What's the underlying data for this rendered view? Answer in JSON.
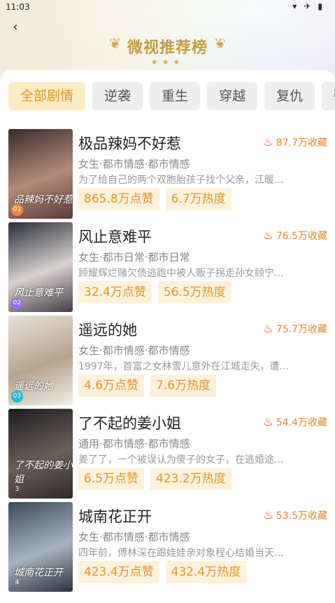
{
  "status": {
    "time": "11:03"
  },
  "header": {
    "back_icon": "‹",
    "title": "微视推荐榜",
    "stars": "★★★"
  },
  "tabs": [
    {
      "label": "全部剧情",
      "active": true
    },
    {
      "label": "逆袭",
      "active": false
    },
    {
      "label": "重生",
      "active": false
    },
    {
      "label": "穿越",
      "active": false
    },
    {
      "label": "复仇",
      "active": false
    },
    {
      "label": "强",
      "active": false
    }
  ],
  "items": [
    {
      "rank": "01",
      "rank_color": "#f0893a",
      "cover_text": "品辣妈不好惹",
      "cover_colors": [
        "#3a2b2b",
        "#b38b7a",
        "#5b3c3a"
      ],
      "title": "极品辣妈不好惹",
      "favorites": "87.7万收藏",
      "meta": "女生·都市情感·都市情感",
      "desc": "为了给自己的两个双胞胎孩子找个父亲，江暖...",
      "likes": "865.8万点赞",
      "heat": "6.7万热度"
    },
    {
      "rank": "02",
      "rank_color": "#9a6ee6",
      "cover_text": "风止意难平",
      "cover_colors": [
        "#2a2e3a",
        "#d8d1cf",
        "#443d44"
      ],
      "title": "风止意难平",
      "favorites": "76.5万收藏",
      "meta": "女生·都市日常·都市日常",
      "desc": "顾耀辉烂赌欠债逃跑中被人贩子拐走孙女顾宁...",
      "likes": "32.4万点赞",
      "heat": "56.5万热度"
    },
    {
      "rank": "03",
      "rank_color": "#27b7d7",
      "cover_text": "遥远的她",
      "cover_colors": [
        "#e9e2d8",
        "#b5a48f",
        "#f3efe8"
      ],
      "title": "遥远的她",
      "favorites": "75.7万收藏",
      "meta": "女生·都市情感·都市情感",
      "desc": "1997年，首富之女林雪儿意外在江城走失，遭...",
      "likes": "4.6万点赞",
      "heat": "7.6万热度"
    },
    {
      "rank": "3",
      "rank_color": "rgba(0,0,0,0)",
      "cover_text": "了不起的姜小姐",
      "cover_colors": [
        "#1d1d1f",
        "#6b5f5a",
        "#2e2a2a"
      ],
      "title": "了不起的姜小姐",
      "favorites": "54.4万收藏",
      "meta": "通用·都市情感·都市情感",
      "desc": "姜了了，一个被误认为傻子的女子，在逃婚途...",
      "likes": "6.5万点赞",
      "heat": "423.2万热度"
    },
    {
      "rank": "4",
      "rank_color": "rgba(0,0,0,0)",
      "cover_text": "城南花正开",
      "cover_colors": [
        "#3b4a5a",
        "#a7b3bf",
        "#2b3440"
      ],
      "title": "城南花正开",
      "favorites": "53.5万收藏",
      "meta": "女生·都市情感·都市情感",
      "desc": "四年前，傅林深在跟娃娃亲对象程心结婚当天...",
      "likes": "423.4万点赞",
      "heat": "432.4万热度"
    }
  ],
  "colors": {
    "accent": "#e3962a",
    "flame": "#e63b1d"
  }
}
